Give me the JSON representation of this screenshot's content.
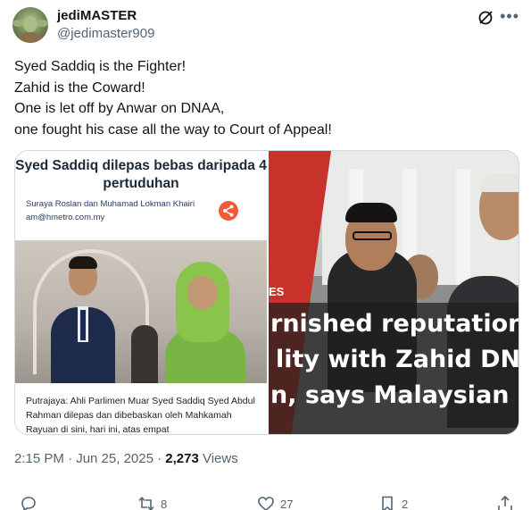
{
  "author": {
    "display_name": "jediMASTER",
    "handle": "@jedimaster909"
  },
  "tweet": {
    "lines": [
      "Syed Saddiq is the Fighter!",
      "Zahid is the Coward!",
      "One is let off by Anwar on DNAA,",
      "one fought his case all the way to Court of Appeal!"
    ]
  },
  "media": {
    "left": {
      "headline": "Syed Saddiq dilepas bebas daripada 4 pertuduhan",
      "author": "Suraya Roslan dan Muhamad Lokman Khairi",
      "email": "am@hmetro.com.my",
      "body": "Putrajaya: Ahli Parlimen Muar Syed Saddiq Syed Abdul Rahman dilepas dan dibebaskan oleh Mahkamah Rayuan di sini, hari ini, atas empat"
    },
    "right": {
      "tag": "ES",
      "caption_lines": [
        "rnished reputation",
        "lity with Zahid DNA",
        "n, says Malaysian E"
      ]
    }
  },
  "meta": {
    "time": "2:15 PM · Jun 25, 2025 · ",
    "views_count": "2,273",
    "views_label": " Views"
  },
  "actions": {
    "replies": "",
    "reposts": "8",
    "likes": "27",
    "bookmarks": "2"
  },
  "colors": {
    "text": "#0f1419",
    "secondary": "#536471",
    "border": "#cfd9de",
    "share": "#f15a38"
  }
}
